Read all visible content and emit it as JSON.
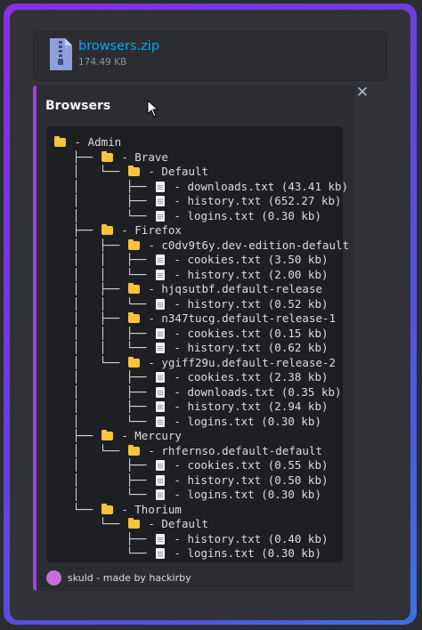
{
  "attachment": {
    "file_name": "browsers.zip",
    "file_size": "174.49 KB",
    "icon": "zip-file-icon"
  },
  "embed": {
    "title": "Browsers",
    "accent_color": "#a43fe0",
    "footer_text": "skuld - made by hackirby",
    "footer_icon": "skuld-logo-icon"
  },
  "tree": [
    {
      "prefix": "",
      "type": "folder",
      "text": " - Admin"
    },
    {
      "prefix": "   ├── ",
      "type": "folder",
      "text": " - Brave"
    },
    {
      "prefix": "   │   └── ",
      "type": "folder",
      "text": " - Default"
    },
    {
      "prefix": "   │       ├── ",
      "type": "file",
      "text": " - downloads.txt (43.41 kb)"
    },
    {
      "prefix": "   │       ├── ",
      "type": "file",
      "text": " - history.txt (652.27 kb)"
    },
    {
      "prefix": "   │       └── ",
      "type": "file",
      "text": " - logins.txt (0.30 kb)"
    },
    {
      "prefix": "   ├── ",
      "type": "folder",
      "text": " - Firefox"
    },
    {
      "prefix": "   │   ├── ",
      "type": "folder",
      "text": " - c0dv9t6y.dev-edition-default"
    },
    {
      "prefix": "   │   │   ├── ",
      "type": "file",
      "text": " - cookies.txt (3.50 kb)"
    },
    {
      "prefix": "   │   │   └── ",
      "type": "file",
      "text": " - history.txt (2.00 kb)"
    },
    {
      "prefix": "   │   ├── ",
      "type": "folder",
      "text": " - hjqsutbf.default-release"
    },
    {
      "prefix": "   │   │   └── ",
      "type": "file",
      "text": " - history.txt (0.52 kb)"
    },
    {
      "prefix": "   │   ├── ",
      "type": "folder",
      "text": " - n347tucg.default-release-1"
    },
    {
      "prefix": "   │   │   ├── ",
      "type": "file",
      "text": " - cookies.txt (0.15 kb)"
    },
    {
      "prefix": "   │   │   └── ",
      "type": "file",
      "text": " - history.txt (0.62 kb)"
    },
    {
      "prefix": "   │   └── ",
      "type": "folder",
      "text": " - ygiff29u.default-release-2"
    },
    {
      "prefix": "   │       ├── ",
      "type": "file",
      "text": " - cookies.txt (2.38 kb)"
    },
    {
      "prefix": "   │       ├── ",
      "type": "file",
      "text": " - downloads.txt (0.35 kb)"
    },
    {
      "prefix": "   │       ├── ",
      "type": "file",
      "text": " - history.txt (2.94 kb)"
    },
    {
      "prefix": "   │       └── ",
      "type": "file",
      "text": " - logins.txt (0.30 kb)"
    },
    {
      "prefix": "   ├── ",
      "type": "folder",
      "text": " - Mercury"
    },
    {
      "prefix": "   │   └── ",
      "type": "folder",
      "text": " - rhfernso.default-default"
    },
    {
      "prefix": "   │       ├── ",
      "type": "file",
      "text": " - cookies.txt (0.55 kb)"
    },
    {
      "prefix": "   │       ├── ",
      "type": "file",
      "text": " - history.txt (0.50 kb)"
    },
    {
      "prefix": "   │       └── ",
      "type": "file",
      "text": " - logins.txt (0.30 kb)"
    },
    {
      "prefix": "   └── ",
      "type": "folder",
      "text": " - Thorium"
    },
    {
      "prefix": "       └── ",
      "type": "folder",
      "text": " - Default"
    },
    {
      "prefix": "           ├── ",
      "type": "file",
      "text": " - history.txt (0.40 kb)"
    },
    {
      "prefix": "           └── ",
      "type": "file",
      "text": " - logins.txt (0.30 kb)"
    }
  ]
}
